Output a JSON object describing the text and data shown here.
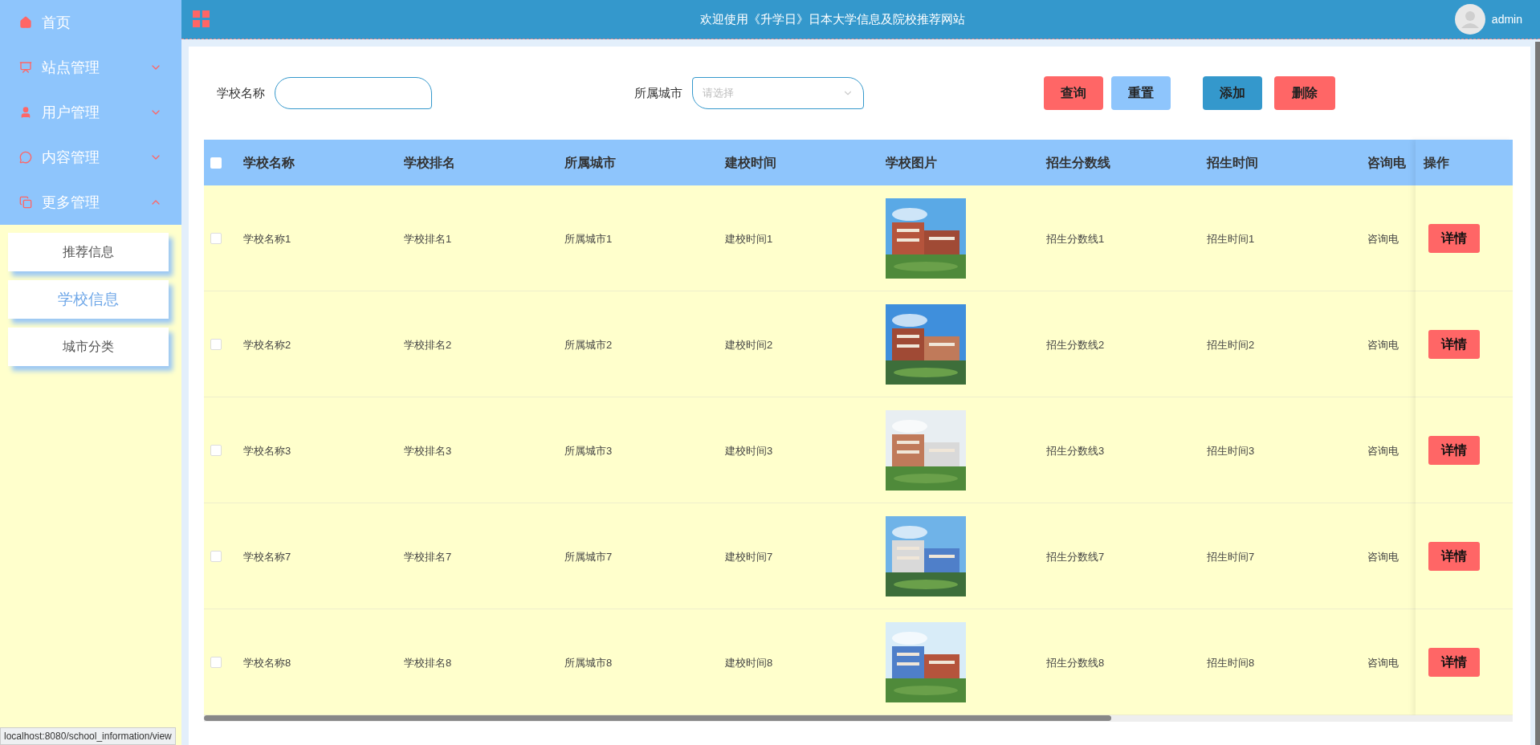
{
  "header": {
    "title": "欢迎使用《升学日》日本大学信息及院校推荐网站",
    "user": "admin"
  },
  "sidebar": {
    "items": [
      {
        "label": "首页",
        "kind": "link"
      },
      {
        "label": "站点管理",
        "kind": "menu",
        "expanded": false
      },
      {
        "label": "用户管理",
        "kind": "menu",
        "expanded": false
      },
      {
        "label": "内容管理",
        "kind": "menu",
        "expanded": false
      },
      {
        "label": "更多管理",
        "kind": "menu",
        "expanded": true
      }
    ],
    "submenu": [
      {
        "label": "推荐信息",
        "selected": false
      },
      {
        "label": "学校信息",
        "selected": true
      },
      {
        "label": "城市分类",
        "selected": false
      }
    ]
  },
  "search": {
    "fields": [
      {
        "label": "学校名称",
        "kind": "text"
      },
      {
        "label": "所属城市",
        "kind": "select",
        "placeholder": "请选择"
      }
    ],
    "buttons": [
      {
        "label": "查询",
        "color": "#ff6666"
      },
      {
        "label": "重置",
        "color": "#8ec5fc"
      },
      {
        "label": "添加",
        "color": "#3498cc"
      },
      {
        "label": "删除",
        "color": "#ff6666"
      }
    ]
  },
  "table": {
    "all_checked": false,
    "columns": [
      "学校名称",
      "学校排名",
      "所属城市",
      "建校时间",
      "学校图片",
      "招生分数线",
      "招生时间",
      "咨询电"
    ],
    "action_column": "操作",
    "rows": [
      {
        "checked": false,
        "cells": [
          "学校名称1",
          "学校排名1",
          "所属城市1",
          "建校时间1",
          {
            "kind": "picture"
          },
          "招生分数线1",
          "招生时间1",
          "咨询电"
        ],
        "action": "详情"
      },
      {
        "checked": false,
        "cells": [
          "学校名称2",
          "学校排名2",
          "所属城市2",
          "建校时间2",
          {
            "kind": "picture"
          },
          "招生分数线2",
          "招生时间2",
          "咨询电"
        ],
        "action": "详情"
      },
      {
        "checked": false,
        "cells": [
          "学校名称3",
          "学校排名3",
          "所属城市3",
          "建校时间3",
          {
            "kind": "picture"
          },
          "招生分数线3",
          "招生时间3",
          "咨询电"
        ],
        "action": "详情"
      },
      {
        "checked": false,
        "cells": [
          "学校名称7",
          "学校排名7",
          "所属城市7",
          "建校时间7",
          {
            "kind": "picture"
          },
          "招生分数线7",
          "招生时间7",
          "咨询电"
        ],
        "action": "详情"
      },
      {
        "checked": false,
        "cells": [
          "学校名称8",
          "学校排名8",
          "所属城市8",
          "建校时间8",
          {
            "kind": "picture"
          },
          "招生分数线8",
          "招生时间8",
          "咨询电"
        ],
        "action": "详情"
      }
    ]
  },
  "status_bar": "localhost:8080/school_information/view"
}
